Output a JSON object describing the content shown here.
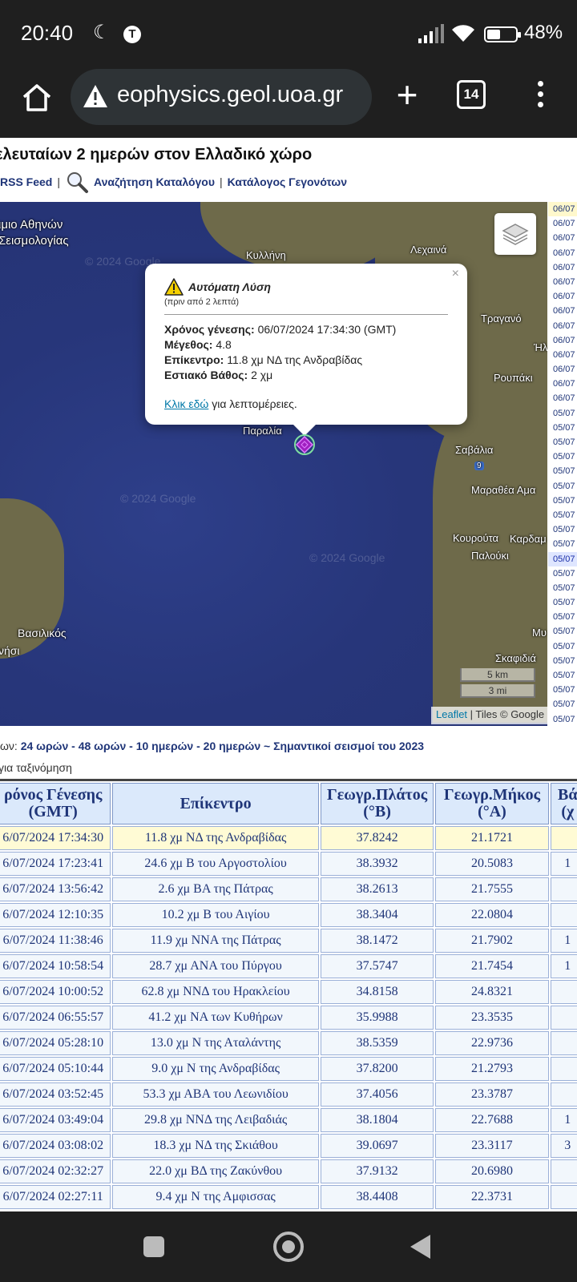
{
  "status_bar": {
    "time": "20:40",
    "battery": "48%"
  },
  "browser": {
    "url": "eophysics.geol.uoa.gr",
    "tab_count": "14"
  },
  "page": {
    "heading": "ελευταίων 2 ημερών στον Ελλαδικό χώρο",
    "links": {
      "rss": "RSS Feed",
      "search": "Αναζήτηση Καταλόγου",
      "catalog": "Κατάλογος Γεγονότων",
      "sep": "|"
    }
  },
  "map": {
    "labels": {
      "institute1": "ιμιο Αθηνών",
      "institute2": "Σεισμολογίας",
      "kyllini": "Κυλλήνη",
      "lechaina": "Λεχαινά",
      "tragano": "Τραγανό",
      "roupaki": "Ρουπάκι",
      "paralia": "Παραλία",
      "savalia": "Σαβάλια",
      "marathea": "Μαραθέα Αμα",
      "kouroyta": "Κουρούτα",
      "kardam": "Καρδαμ",
      "palouki": "Παλούκι",
      "vasilikos": "Βασιλικός",
      "nisi": "νήσι",
      "skafidia": "Σκαφιδιά",
      "mu": "Μυ",
      "eta": "Ήλ",
      "road9": "9"
    },
    "watermark": "© 2024 Google",
    "scale": {
      "km": "5 km",
      "mi": "3 mi"
    },
    "attribution": {
      "leaflet": "Leaflet",
      "tiles": "| Tiles © Google"
    },
    "popup": {
      "title": "Αυτόματη Λύση",
      "ago": "(πριν από 2 λεπτά)",
      "time_label": "Χρόνος γένεσης:",
      "time_value": "06/07/2024 17:34:30 (GMT)",
      "mag_label": "Μέγεθος:",
      "mag_value": "4.8",
      "epi_label": "Επίκεντρο:",
      "epi_value": "11.8 χμ ΝΔ της Ανδραβίδας",
      "depth_label": "Εστιακό Βάθος:",
      "depth_value": "2 χμ",
      "link": "Κλικ εδώ",
      "link_suffix": "για λεπτομέρειες.",
      "close": "×"
    },
    "side_dates": [
      "06/07",
      "06/07",
      "06/07",
      "06/07",
      "06/07",
      "06/07",
      "06/07",
      "06/07",
      "06/07",
      "06/07",
      "06/07",
      "06/07",
      "06/07",
      "06/07",
      "05/07",
      "05/07",
      "05/07",
      "05/07",
      "05/07",
      "05/07",
      "05/07",
      "05/07",
      "05/07",
      "05/07",
      "05/07",
      "05/07",
      "05/07",
      "05/07",
      "05/07",
      "05/07",
      "05/07",
      "05/07",
      "05/07",
      "05/07",
      "05/07",
      "05/07"
    ]
  },
  "periods": {
    "prefix": "ων: ",
    "text": "24 ωρών - 48 ωρών - 10 ημερών - 20 ημερών ~ Σημαντικοί σεισμοί του 2023"
  },
  "sort_note": "για ταξινόμηση",
  "table": {
    "headers": [
      "ρόνος Γένεσης (GMT)",
      "Επίκεντρο",
      "Γεωγρ.Πλάτος (°Β)",
      "Γεωγρ.Μήκος (°Α)",
      "Βά (χ"
    ],
    "rows": [
      [
        "6/07/2024 17:34:30",
        "11.8 χμ ΝΔ της Ανδραβίδας",
        "37.8242",
        "21.1721",
        ""
      ],
      [
        "6/07/2024 17:23:41",
        "24.6 χμ Β του Αργοστολίου",
        "38.3932",
        "20.5083",
        "1"
      ],
      [
        "6/07/2024 13:56:42",
        "2.6 χμ ΒΑ της Πάτρας",
        "38.2613",
        "21.7555",
        ""
      ],
      [
        "6/07/2024 12:10:35",
        "10.2 χμ Β του Αιγίου",
        "38.3404",
        "22.0804",
        ""
      ],
      [
        "6/07/2024 11:38:46",
        "11.9 χμ ΝΝΑ της Πάτρας",
        "38.1472",
        "21.7902",
        "1"
      ],
      [
        "6/07/2024 10:58:54",
        "28.7 χμ ΑΝΑ του Πύργου",
        "37.5747",
        "21.7454",
        "1"
      ],
      [
        "6/07/2024 10:00:52",
        "62.8 χμ ΝΝΔ του Ηρακλείου",
        "34.8158",
        "24.8321",
        ""
      ],
      [
        "6/07/2024 06:55:57",
        "41.2 χμ ΝΑ των Κυθήρων",
        "35.9988",
        "23.3535",
        ""
      ],
      [
        "6/07/2024 05:28:10",
        "13.0 χμ Ν της Αταλάντης",
        "38.5359",
        "22.9736",
        ""
      ],
      [
        "6/07/2024 05:10:44",
        "9.0 χμ Ν της Ανδραβίδας",
        "37.8200",
        "21.2793",
        ""
      ],
      [
        "6/07/2024 03:52:45",
        "53.3 χμ ΑΒΑ του Λεωνιδίου",
        "37.4056",
        "23.3787",
        ""
      ],
      [
        "6/07/2024 03:49:04",
        "29.8 χμ ΝΝΔ της Λειβαδιάς",
        "38.1804",
        "22.7688",
        "1"
      ],
      [
        "6/07/2024 03:08:02",
        "18.3 χμ ΝΔ της Σκιάθου",
        "39.0697",
        "23.3117",
        "3"
      ],
      [
        "6/07/2024 02:32:27",
        "22.0 χμ ΒΔ της Ζακύνθου",
        "37.9132",
        "20.6980",
        ""
      ],
      [
        "6/07/2024 02:27:11",
        "9.4 χμ Ν της Αμφισσας",
        "38.4408",
        "22.3731",
        ""
      ]
    ]
  }
}
